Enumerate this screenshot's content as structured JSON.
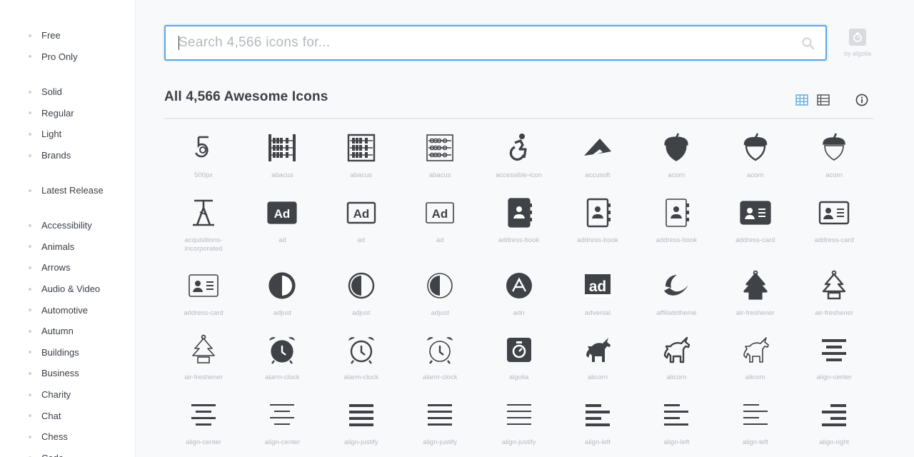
{
  "sidebar": {
    "license": [
      "Free",
      "Pro Only"
    ],
    "styles": [
      "Solid",
      "Regular",
      "Light",
      "Brands"
    ],
    "release": [
      "Latest Release"
    ],
    "categories": [
      "Accessibility",
      "Animals",
      "Arrows",
      "Audio & Video",
      "Automotive",
      "Autumn",
      "Buildings",
      "Business",
      "Charity",
      "Chat",
      "Chess",
      "Code"
    ]
  },
  "search": {
    "placeholder": "Search 4,566 icons for...",
    "value": "",
    "powered_by": "by algolia"
  },
  "heading": "All 4,566 Awesome Icons",
  "view_modes": [
    "grid-icon",
    "list-icon",
    "info-icon"
  ],
  "accent_color": "#5aa7e0",
  "icon_color": "#3f4247",
  "icons": [
    {
      "name": "500px",
      "icon": "500px-icon"
    },
    {
      "name": "abacus",
      "icon": "abacus-icon"
    },
    {
      "name": "abacus",
      "icon": "abacus-icon"
    },
    {
      "name": "abacus",
      "icon": "abacus-icon"
    },
    {
      "name": "accessible-icon",
      "icon": "accessible-icon"
    },
    {
      "name": "accusoft",
      "icon": "accusoft-icon"
    },
    {
      "name": "acorn",
      "icon": "acorn-icon"
    },
    {
      "name": "acorn",
      "icon": "acorn-icon"
    },
    {
      "name": "acorn",
      "icon": "acorn-icon"
    },
    {
      "name": "acquisitions-incorporated",
      "icon": "acquisitions-incorporated-icon"
    },
    {
      "name": "ad",
      "icon": "ad-icon"
    },
    {
      "name": "ad",
      "icon": "ad-icon"
    },
    {
      "name": "ad",
      "icon": "ad-icon"
    },
    {
      "name": "address-book",
      "icon": "address-book-icon"
    },
    {
      "name": "address-book",
      "icon": "address-book-icon"
    },
    {
      "name": "address-book",
      "icon": "address-book-icon"
    },
    {
      "name": "address-card",
      "icon": "address-card-icon"
    },
    {
      "name": "address-card",
      "icon": "address-card-icon"
    },
    {
      "name": "address-card",
      "icon": "address-card-icon"
    },
    {
      "name": "adjust",
      "icon": "adjust-icon"
    },
    {
      "name": "adjust",
      "icon": "adjust-icon"
    },
    {
      "name": "adjust",
      "icon": "adjust-icon"
    },
    {
      "name": "adn",
      "icon": "adn-icon"
    },
    {
      "name": "adversal",
      "icon": "adversal-icon"
    },
    {
      "name": "affiliatetheme",
      "icon": "affiliatetheme-icon"
    },
    {
      "name": "air-freshener",
      "icon": "air-freshener-icon"
    },
    {
      "name": "air-freshener",
      "icon": "air-freshener-icon"
    },
    {
      "name": "air-freshener",
      "icon": "air-freshener-icon"
    },
    {
      "name": "alarm-clock",
      "icon": "alarm-clock-icon"
    },
    {
      "name": "alarm-clock",
      "icon": "alarm-clock-icon"
    },
    {
      "name": "alarm-clock",
      "icon": "alarm-clock-icon"
    },
    {
      "name": "algolia",
      "icon": "algolia-icon"
    },
    {
      "name": "alicorn",
      "icon": "alicorn-icon"
    },
    {
      "name": "alicorn",
      "icon": "alicorn-icon"
    },
    {
      "name": "alicorn",
      "icon": "alicorn-icon"
    },
    {
      "name": "align-center",
      "icon": "align-center-icon"
    },
    {
      "name": "align-center",
      "icon": "align-center-icon"
    },
    {
      "name": "align-center",
      "icon": "align-center-icon"
    },
    {
      "name": "align-justify",
      "icon": "align-justify-icon"
    },
    {
      "name": "align-justify",
      "icon": "align-justify-icon"
    },
    {
      "name": "align-justify",
      "icon": "align-justify-icon"
    },
    {
      "name": "align-left",
      "icon": "align-left-icon"
    },
    {
      "name": "align-left",
      "icon": "align-left-icon"
    },
    {
      "name": "align-left",
      "icon": "align-left-icon"
    },
    {
      "name": "align-right",
      "icon": "align-right-icon"
    }
  ]
}
